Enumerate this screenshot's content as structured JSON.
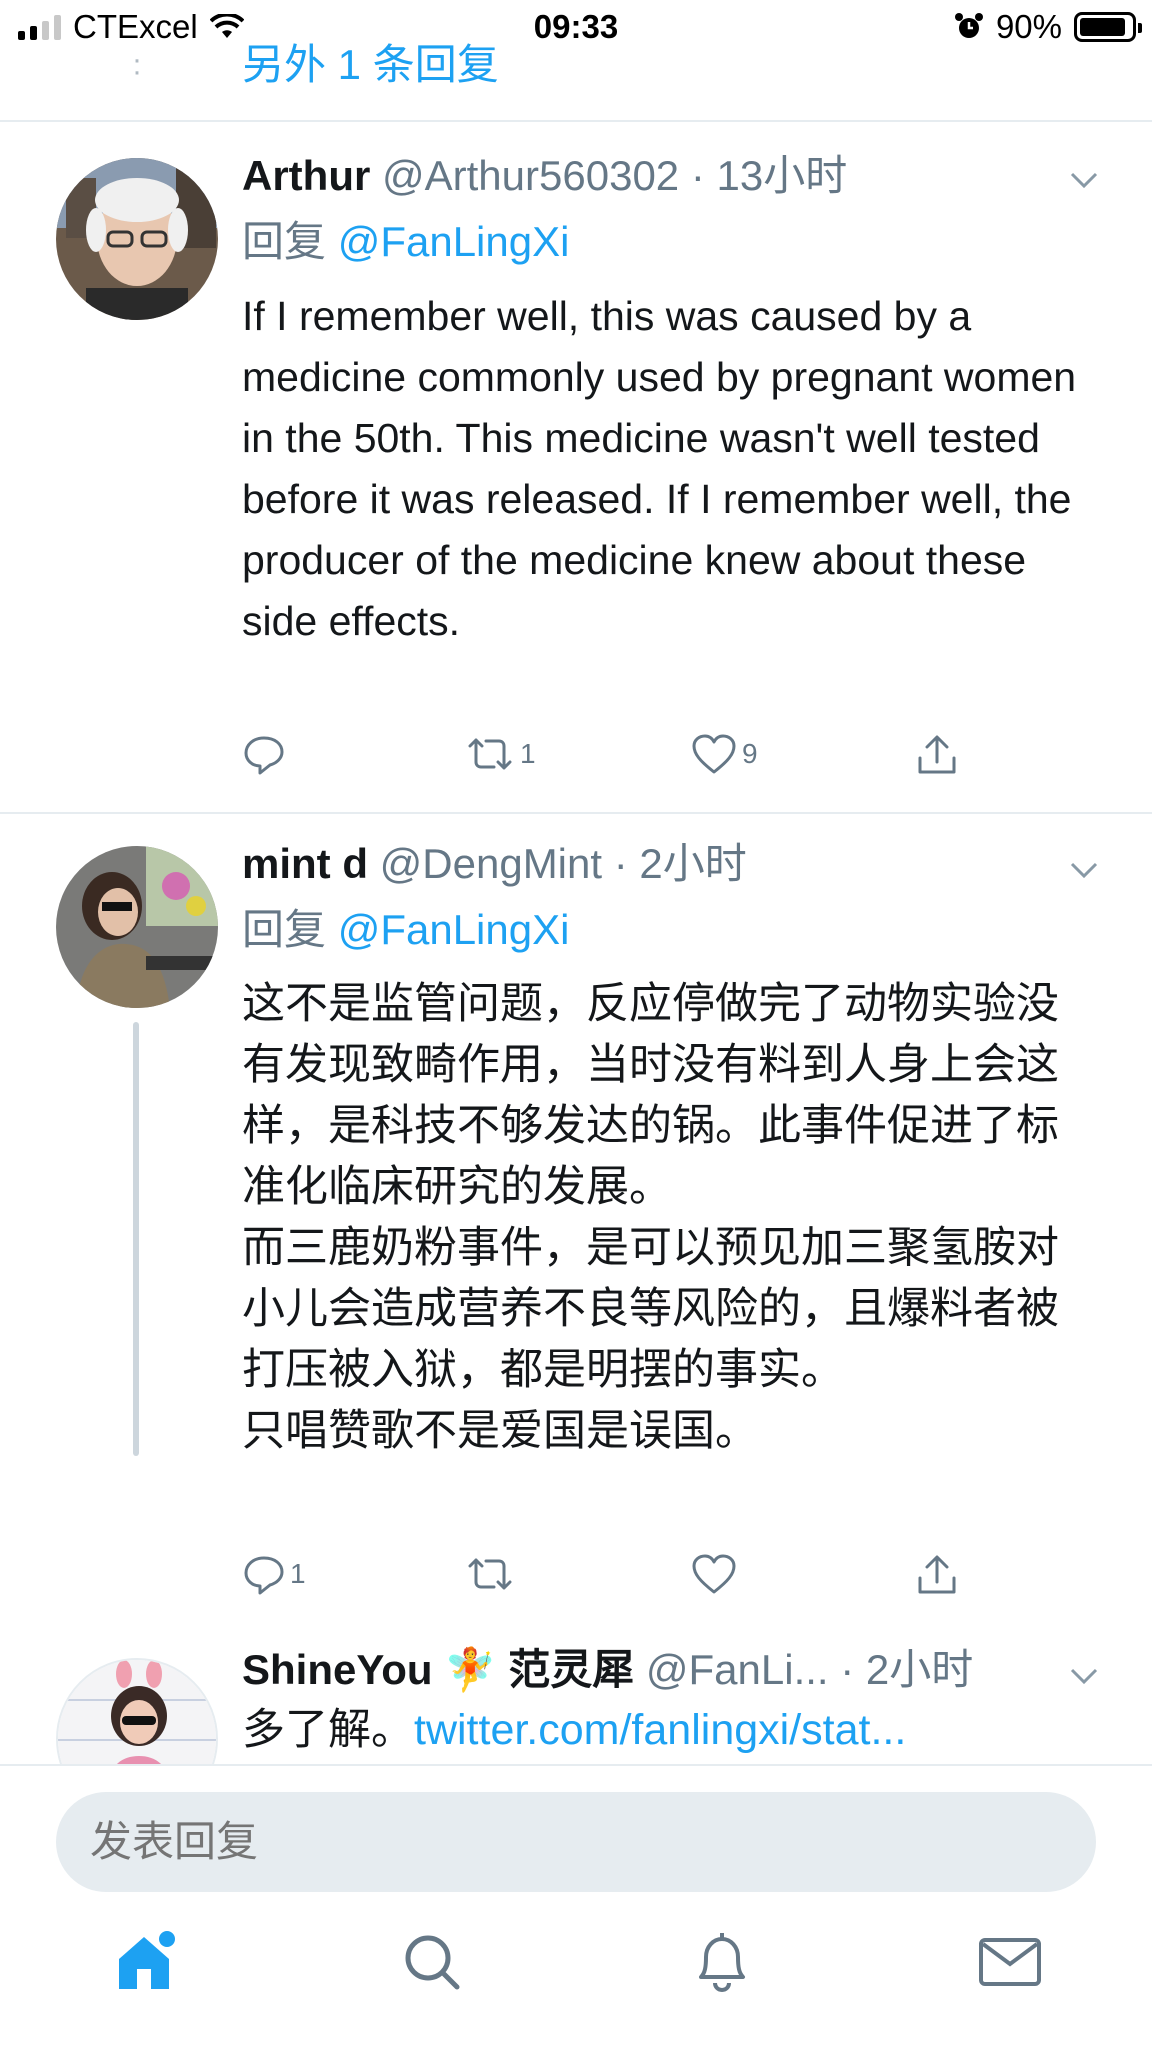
{
  "status_bar": {
    "carrier": "CTExcel",
    "time": "09:33",
    "battery": "90%",
    "battery_level": 0.9
  },
  "top": {
    "more_replies": "另外 1 条回复"
  },
  "tweets": [
    {
      "name": "Arthur",
      "handle": "@Arthur560302",
      "time": "· 13小时",
      "reply_prefix": "回复",
      "reply_to": "@FanLingXi",
      "text": "If I remember well, this was caused by a medicine commonly used by pregnant women in the 50th. This medicine wasn't well tested before it was released. If I remember well, the producer of the medicine knew about these side effects.",
      "replies": "",
      "retweets": "1",
      "likes": "9"
    },
    {
      "name": "mint d",
      "handle": "@DengMint",
      "time": "· 2小时",
      "reply_prefix": "回复",
      "reply_to": "@FanLingXi",
      "text": "这不是监管问题，反应停做完了动物实验没有发现致畸作用，当时没有料到人身上会这样，是科技不够发达的锅。此事件促进了标准化临床研究的发展。\n而三鹿奶粉事件，是可以预见加三聚氢胺对小儿会造成营养不良等风险的，且爆料者被打压被入狱，都是明摆的事实。\n只唱赞歌不是爱国是误国。",
      "replies": "1",
      "retweets": "",
      "likes": ""
    },
    {
      "name": "ShineYou",
      "emoji": "🧚",
      "name_cn": "范灵犀",
      "handle": "@FanLi...",
      "time": "· 2小时",
      "text_prefix": "多了解。",
      "link": "twitter.com/fanlingxi/stat..."
    }
  ],
  "reply_bar": {
    "placeholder": "发表回复"
  },
  "tabs": [
    "home-icon",
    "search-icon",
    "bell-icon",
    "mail-icon"
  ],
  "colors": {
    "accent": "#1da1f2",
    "meta": "#657786",
    "divider": "#e6ecf0"
  }
}
